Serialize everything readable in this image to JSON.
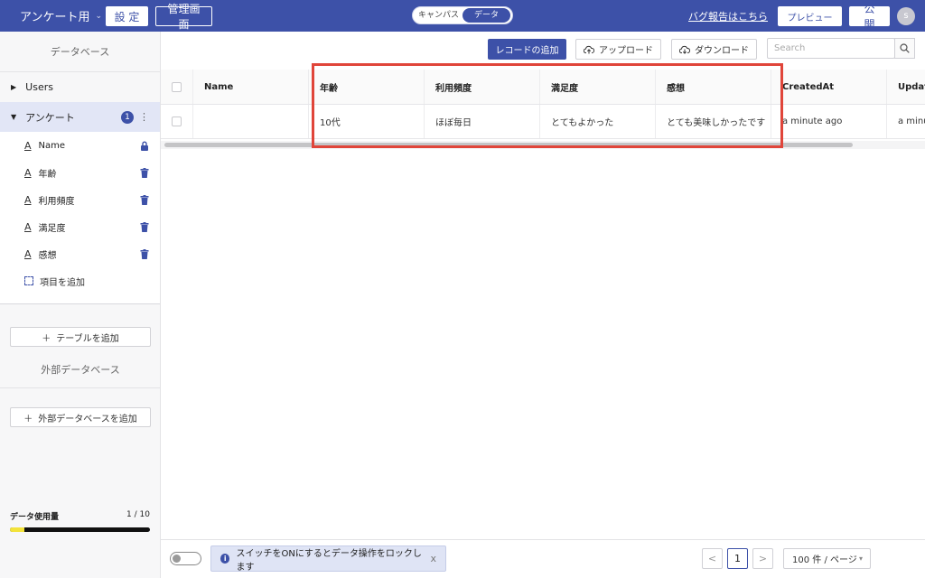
{
  "topbar": {
    "app_name": "アンケート用",
    "settings_label": "設 定",
    "admin_label": "管理画面",
    "view_toggle": {
      "canvas": "キャンパス",
      "data": "データ",
      "active": "data"
    },
    "bug_report_link": "バグ報告はこちら",
    "preview_label": "プレビュー",
    "publish_label": "公 開",
    "avatar_initial": "s",
    "colors": {
      "bar": "#3d51a8"
    }
  },
  "sidebar": {
    "heading": "データベース",
    "tables": [
      {
        "name": "Users"
      },
      {
        "name": "アンケート",
        "badge": "1"
      }
    ],
    "fields": [
      {
        "name": "Name",
        "action_icon": "lock-icon"
      },
      {
        "name": "年齢",
        "action_icon": "trash-icon"
      },
      {
        "name": "利用頻度",
        "action_icon": "trash-icon"
      },
      {
        "name": "満足度",
        "action_icon": "trash-icon"
      },
      {
        "name": "感想",
        "action_icon": "trash-icon"
      }
    ],
    "add_field_label": "項目を追加",
    "add_table_label": "テーブルを追加",
    "external_heading": "外部データベース",
    "add_external_label": "外部データベースを追加",
    "usage": {
      "label": "データ使用量",
      "count": "1 / 10",
      "fraction": 0.1,
      "fill_color": "#f3e33b"
    }
  },
  "toolbar": {
    "add_record_label": "レコードの追加",
    "upload_label": "アップロード",
    "download_label": "ダウンロード",
    "search_placeholder": "Search"
  },
  "table": {
    "columns": [
      "Name",
      "年齢",
      "利用頻度",
      "満足度",
      "感想",
      "CreatedAt",
      "Update"
    ],
    "rows": [
      [
        "",
        "10代",
        "ほぼ毎日",
        "とてもよかった",
        "とても美味しかったです",
        "a minute ago",
        "a minu"
      ]
    ]
  },
  "footer": {
    "notice_text": "スイッチをONにするとデータ操作をロックします",
    "close_label": "x",
    "prev_label": "<",
    "current_page": "1",
    "next_label": ">",
    "per_page_label": "100 件 / ページ"
  }
}
